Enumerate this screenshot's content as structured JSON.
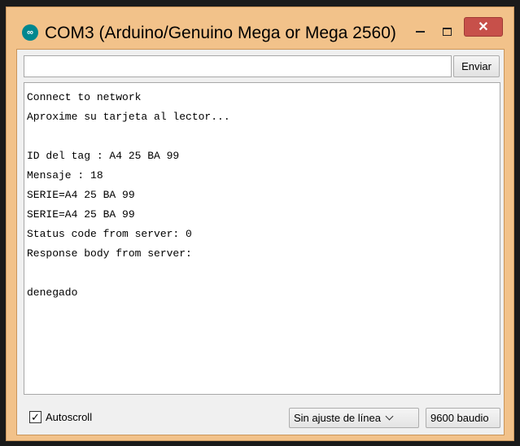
{
  "window": {
    "title": "COM3 (Arduino/Genuino Mega or Mega 2560)",
    "icon": "arduino-icon",
    "controls": {
      "minimize": "minimize-icon",
      "maximize": "maximize-icon",
      "close": "✕"
    }
  },
  "send": {
    "input_value": "",
    "button_label": "Enviar"
  },
  "output": {
    "lines": [
      "Connect to network",
      "Aproxime su tarjeta al lector...",
      "",
      "ID del tag : A4 25 BA 99",
      "Mensaje : 18",
      "SERIE=A4 25 BA 99",
      "SERIE=A4 25 BA 99",
      "Status code from server: 0",
      "Response body from server:",
      "",
      "denegado"
    ]
  },
  "footer": {
    "autoscroll_label": "Autoscroll",
    "autoscroll_checked": true,
    "autoscroll_mark": "✓",
    "line_ending": "Sin ajuste de línea",
    "baud_rate": "9600 baudio"
  },
  "colors": {
    "titlebar": "#f2c28a",
    "close_button": "#c7504a",
    "arduino_teal": "#00878f"
  }
}
